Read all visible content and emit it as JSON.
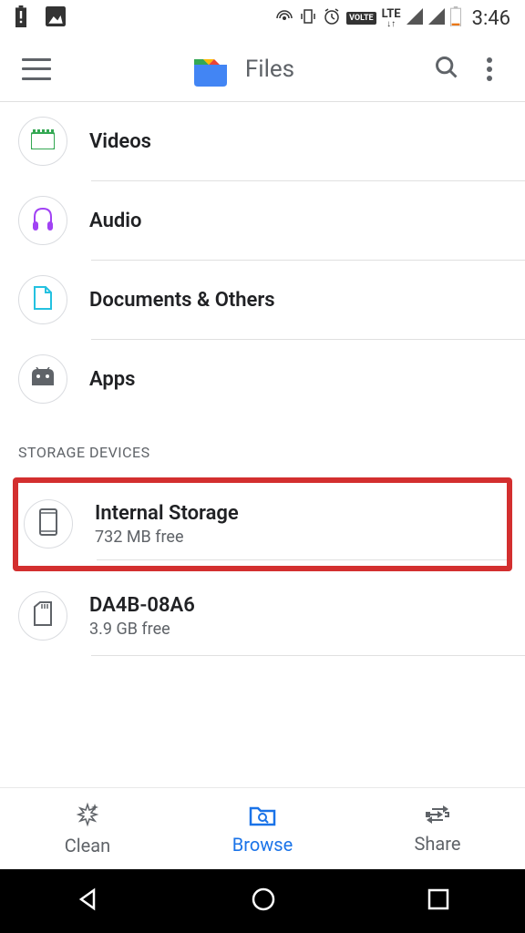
{
  "status_bar": {
    "time": "3:46"
  },
  "app_bar": {
    "title": "Files"
  },
  "categories": [
    {
      "id": "videos",
      "label": "Videos",
      "icon": "videos"
    },
    {
      "id": "audio",
      "label": "Audio",
      "icon": "audio"
    },
    {
      "id": "documents",
      "label": "Documents & Others",
      "icon": "documents"
    },
    {
      "id": "apps",
      "label": "Apps",
      "icon": "apps"
    }
  ],
  "storage_section": {
    "header": "STORAGE DEVICES",
    "devices": [
      {
        "id": "internal",
        "label": "Internal Storage",
        "subtext": "732 MB free",
        "highlighted": true
      },
      {
        "id": "sdcard",
        "label": "DA4B-08A6",
        "subtext": "3.9 GB free",
        "highlighted": false
      }
    ]
  },
  "bottom_nav": {
    "tabs": [
      {
        "id": "clean",
        "label": "Clean",
        "active": false
      },
      {
        "id": "browse",
        "label": "Browse",
        "active": true
      },
      {
        "id": "share",
        "label": "Share",
        "active": false
      }
    ]
  }
}
